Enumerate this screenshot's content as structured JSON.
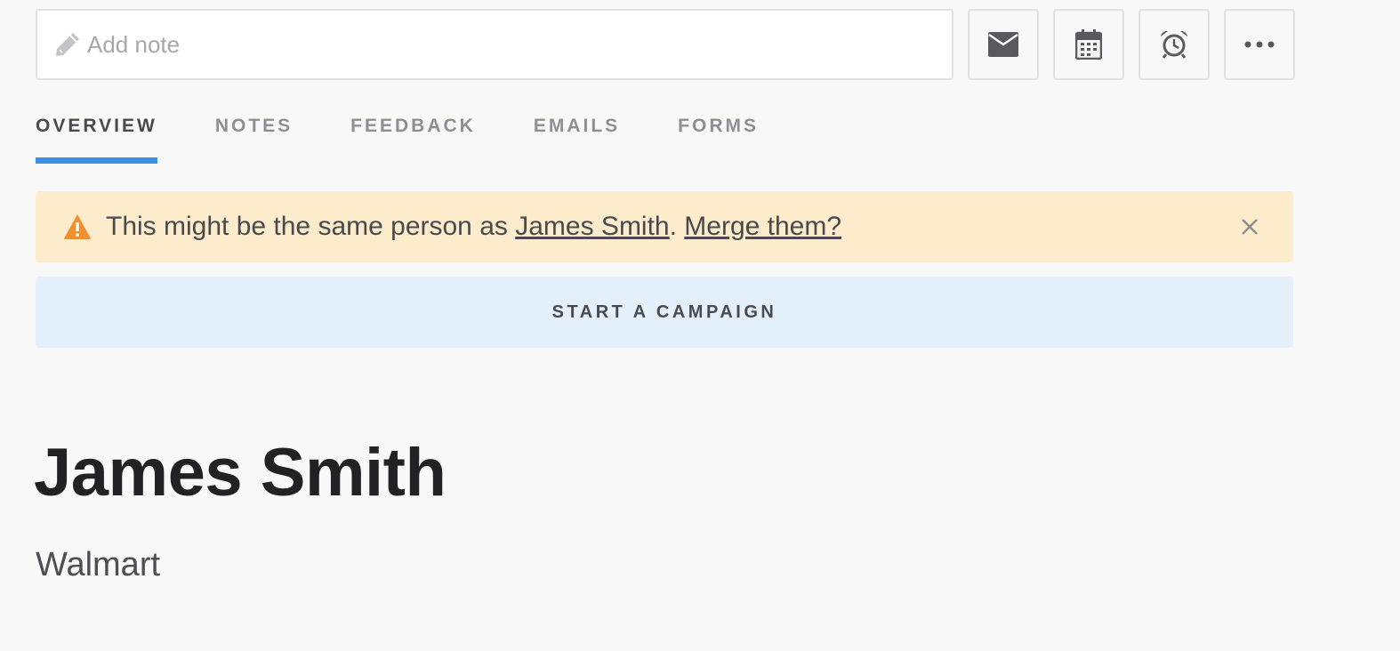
{
  "note": {
    "placeholder": "Add note",
    "value": ""
  },
  "toolbar": {
    "buttons": [
      {
        "name": "email-button",
        "icon": "envelope-icon"
      },
      {
        "name": "calendar-button",
        "icon": "calendar-icon"
      },
      {
        "name": "reminder-button",
        "icon": "alarm-clock-icon"
      },
      {
        "name": "more-button",
        "icon": "ellipsis-icon"
      }
    ]
  },
  "tabs": [
    {
      "label": "OVERVIEW",
      "active": true
    },
    {
      "label": "NOTES",
      "active": false
    },
    {
      "label": "FEEDBACK",
      "active": false
    },
    {
      "label": "EMAILS",
      "active": false
    },
    {
      "label": "FORMS",
      "active": false
    }
  ],
  "warning": {
    "prefix": "This might be the same person as ",
    "link_name": "James Smith",
    "separator": ". ",
    "merge_link": "Merge them?",
    "icon": "warning-triangle-icon",
    "close_icon": "close-icon"
  },
  "campaign": {
    "label": "START A CAMPAIGN"
  },
  "contact": {
    "name": "James Smith",
    "company": "Walmart"
  },
  "colors": {
    "accent": "#3d8fe0",
    "warning_bg": "#fdeccc",
    "warning_icon": "#f0902e",
    "campaign_bg": "#e3f0fb",
    "page_bg": "#f8f8f8"
  }
}
